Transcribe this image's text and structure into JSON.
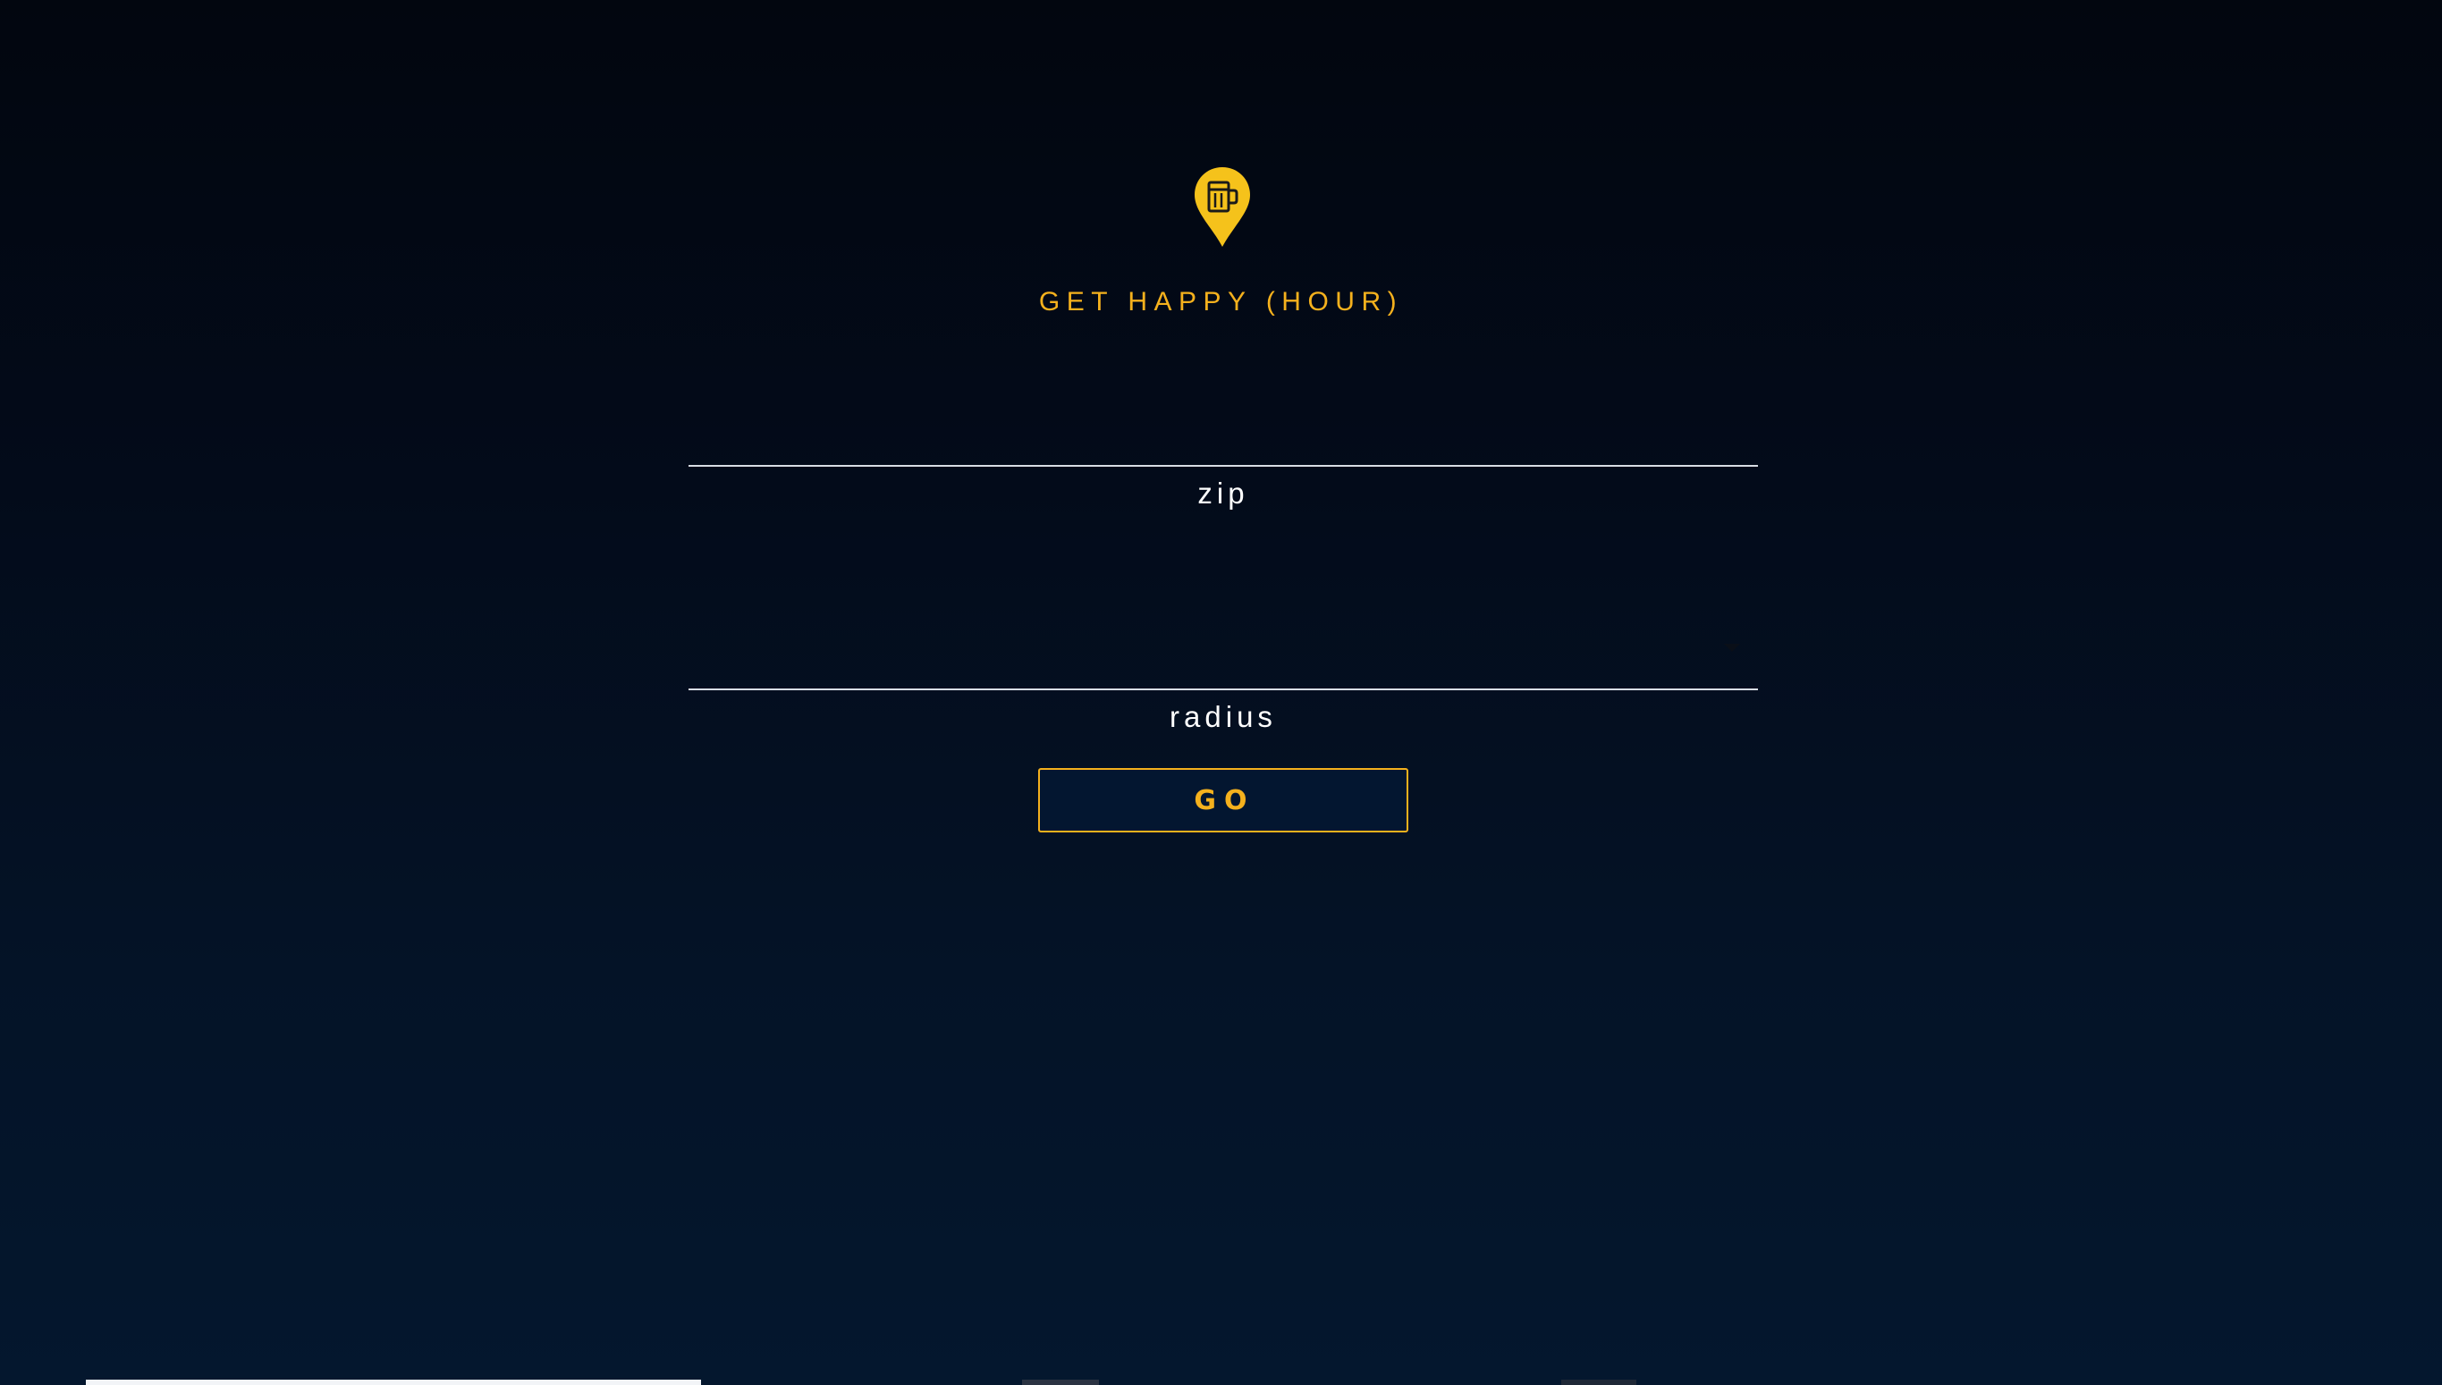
{
  "app": {
    "title": "GET HAPPY (HOUR)",
    "logo_icon": "beer-location-pin-icon",
    "accent_color": "#f5b11d"
  },
  "form": {
    "zip": {
      "label": "zip",
      "value": ""
    },
    "radius": {
      "label": "radius",
      "selected": ""
    },
    "submit_label": "GO"
  }
}
